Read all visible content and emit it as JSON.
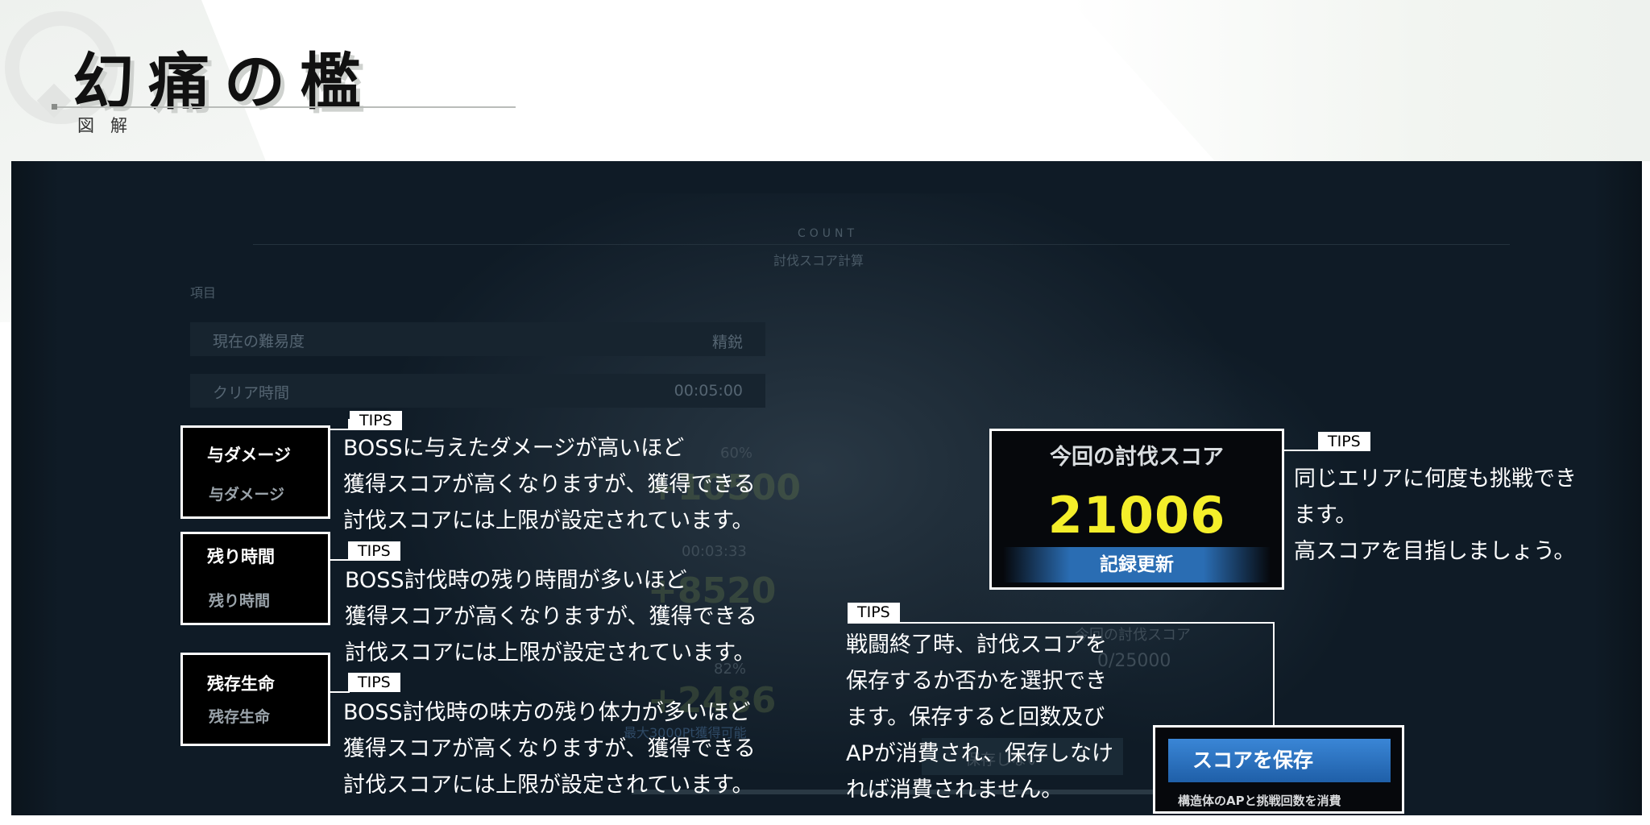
{
  "header": {
    "title": "幻痛の檻",
    "subtitle": "図解"
  },
  "background_ui": {
    "count_label": "COUNT",
    "count_sub": "討伐スコア計算",
    "column_label": "項目",
    "rows": [
      {
        "label": "現在の難易度",
        "value": "精鋭"
      },
      {
        "label": "クリア時間",
        "value": "00:05:00"
      }
    ],
    "faded_texts": {
      "pct1": "60%",
      "score1": "+10500",
      "time2": "00:03:33",
      "score2": "+8520",
      "pct3": "82%",
      "score3": "+2486",
      "max_note": "最大3000Pt獲得可能",
      "this_score_label": "今回の討伐スコア",
      "this_score_value": "0/25000",
      "no_save": "保存しない"
    }
  },
  "callouts": [
    {
      "box_title": "与ダメージ",
      "box_sub": "与ダメージ",
      "tag": "TIPS",
      "lines": [
        "BOSSに与えたダメージが高いほど",
        "獲得スコアが高くなりますが、獲得できる",
        "討伐スコアには上限が設定されています。"
      ]
    },
    {
      "box_title": "残り時間",
      "box_sub": "残り時間",
      "tag": "TIPS",
      "lines": [
        "BOSS討伐時の残り時間が多いほど",
        "獲得スコアが高くなりますが、獲得できる",
        "討伐スコアには上限が設定されています。"
      ]
    },
    {
      "box_title": "残存生命",
      "box_sub": "残存生命",
      "tag": "TIPS",
      "lines": [
        "BOSS討伐時の味方の残り体力が多いほど",
        "獲得スコアが高くなりますが、獲得できる",
        "討伐スコアには上限が設定されています。"
      ]
    }
  ],
  "score_callout": {
    "title": "今回の討伐スコア",
    "value": "21006",
    "banner": "記録更新",
    "tag": "TIPS",
    "lines": [
      "同じエリアに何度も挑戦でき",
      "ます。",
      "高スコアを目指しましょう。"
    ]
  },
  "save_callout": {
    "tag": "TIPS",
    "lines": [
      "戦闘終了時、討伐スコアを",
      "保存するか否かを選択でき",
      "ます。保存すると回数及び",
      "APが消費され、保存しなけ",
      "れば消費されません。"
    ],
    "button_label": "スコアを保存",
    "button_note": "構造体のAPと挑戦回数を消費"
  },
  "colors": {
    "panel_bg": "#0f1b26",
    "score_value": "#f4ee2a",
    "banner_blue": "#2a6db3",
    "button_blue": "#2f77c4"
  }
}
